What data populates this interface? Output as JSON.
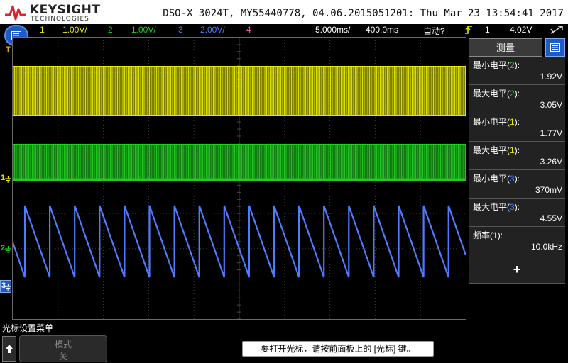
{
  "header": {
    "brand": "KEYSIGHT",
    "brand_sub": "TECHNOLOGIES",
    "title": "DSO-X 3024T, MY55440778, 04.06.2015051201: Thu Mar 23 13:54:41 2017"
  },
  "channel_bar": {
    "ch1_num": "1",
    "ch1_scale": "1.00V/",
    "ch2_num": "2",
    "ch2_scale": "1.00V/",
    "ch3_num": "3",
    "ch3_scale": "2.00V/",
    "ch4_num": "4",
    "timebase": "5.000ms/",
    "delay": "400.0ms",
    "trigger_mode": "自动?",
    "trigger_source": "1",
    "trigger_level": "4.02V",
    "colors": {
      "ch1": "#e8e800",
      "ch2": "#22cc22",
      "ch3": "#4d7cff",
      "ch4": "#ff55aa"
    }
  },
  "markers": {
    "trigger_t": "T",
    "ch1": "1",
    "ch2": "2",
    "ch3": "3"
  },
  "measurements": {
    "tab_label": "测量",
    "items": [
      {
        "label": "最小电平",
        "ch": "2",
        "value": "1.92V"
      },
      {
        "label": "最大电平",
        "ch": "2",
        "value": "3.05V"
      },
      {
        "label": "最小电平",
        "ch": "1",
        "value": "1.77V"
      },
      {
        "label": "最大电平",
        "ch": "1",
        "value": "3.26V"
      },
      {
        "label": "最小电平",
        "ch": "3",
        "value": "370mV"
      },
      {
        "label": "最大电平",
        "ch": "3",
        "value": "4.55V"
      },
      {
        "label": "频率",
        "ch": "1",
        "value": "10.0kHz"
      }
    ],
    "add_label": "+"
  },
  "bottom": {
    "menu_title": "光标设置菜单",
    "softkey_title": "模式",
    "softkey_value": "关",
    "message": "要打开光标，请按前面板上的 [光标] 键。"
  }
}
